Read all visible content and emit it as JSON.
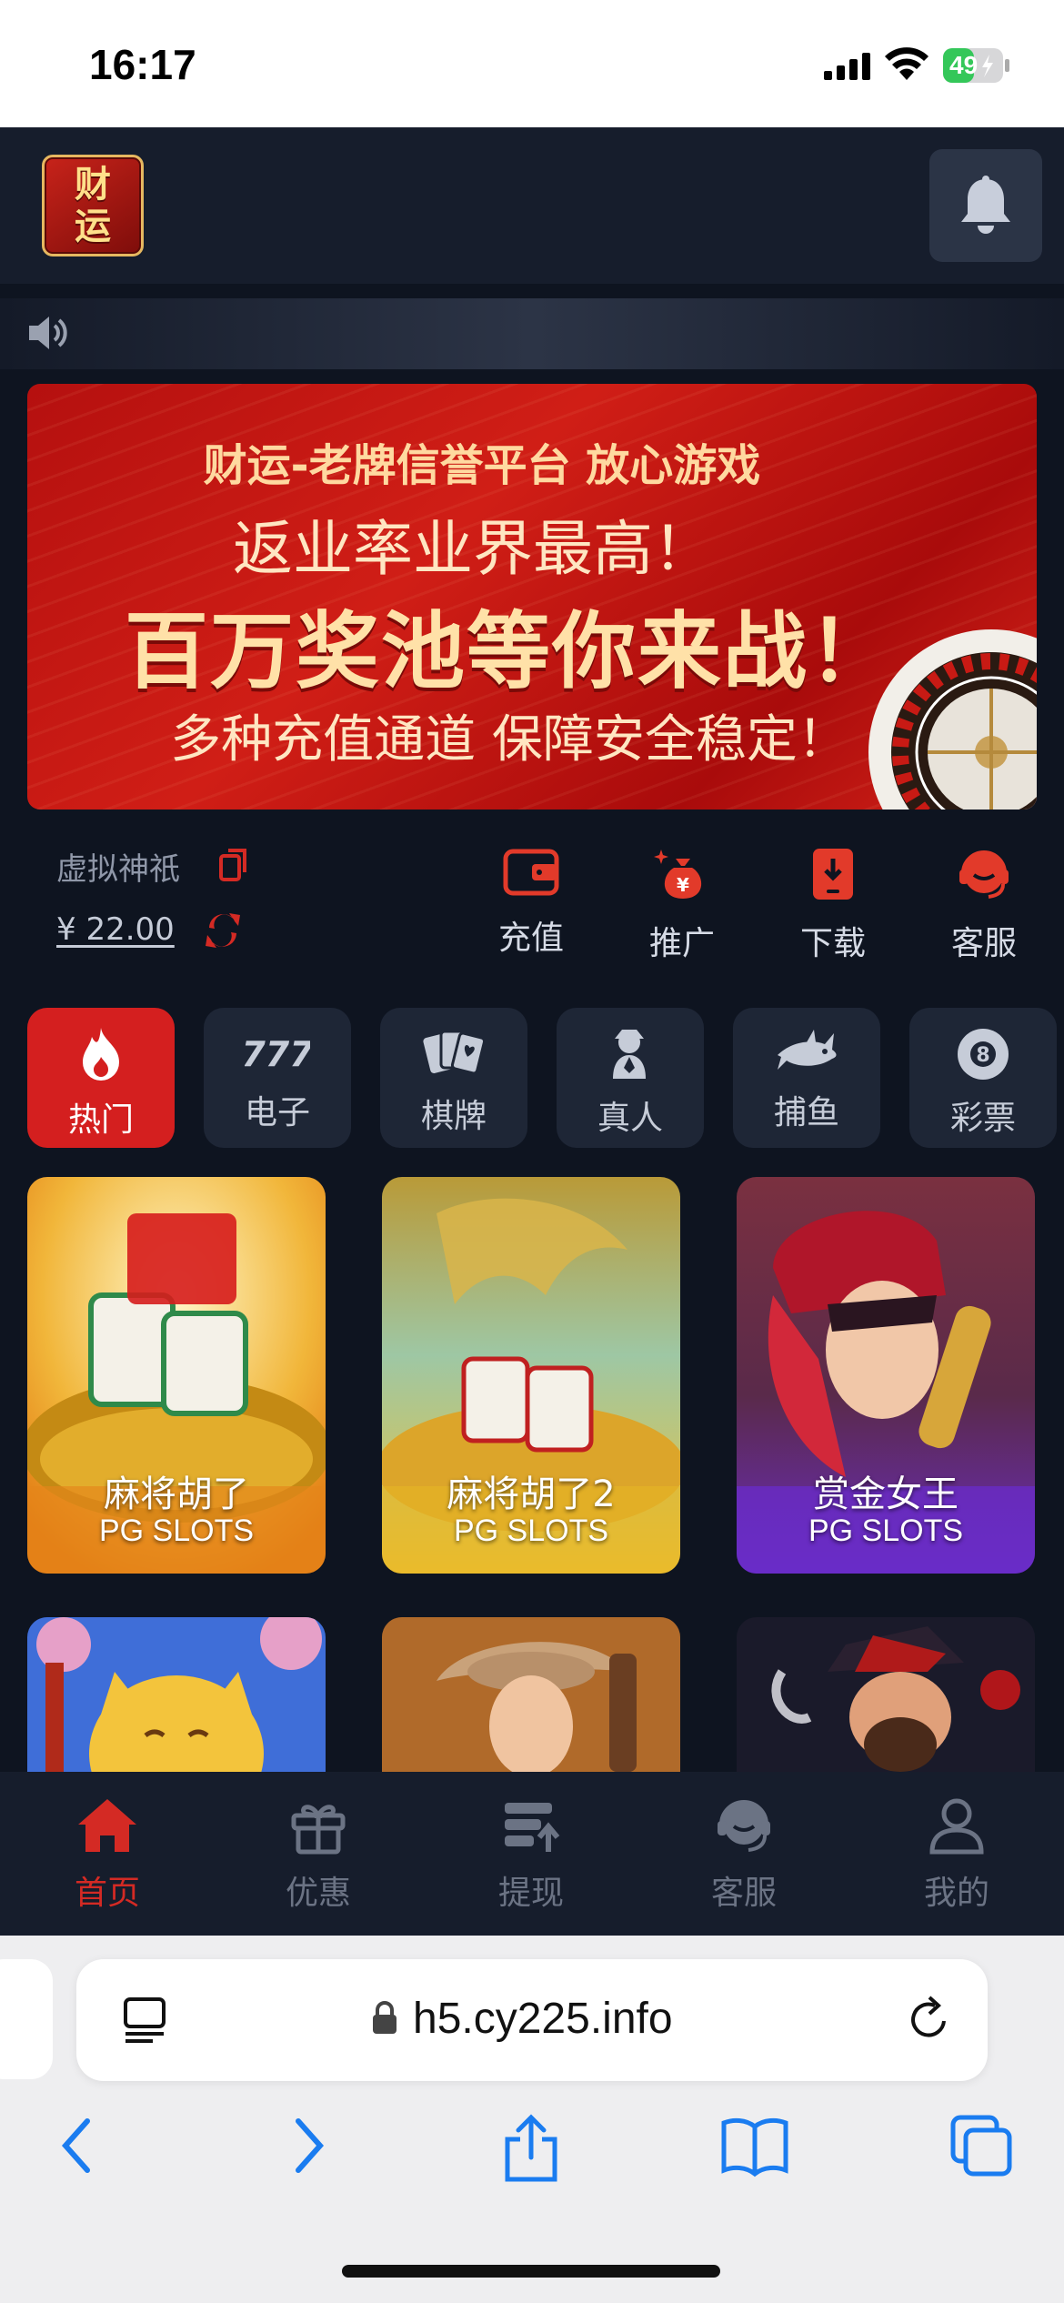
{
  "status_bar": {
    "time": "16:17",
    "battery": "49"
  },
  "header": {
    "logo_top": "财",
    "logo_bottom": "运"
  },
  "banner": {
    "line1": "财运-老牌信誉平台 放心游戏",
    "line2": "返业率业界最高！",
    "line3": "百万奖池等你来战！",
    "line4": "多种充值通道 保障安全稳定！"
  },
  "user": {
    "name": "虚拟神祇",
    "balance": "¥ 22.00"
  },
  "actions": [
    {
      "label": "充值",
      "icon": "wallet-icon"
    },
    {
      "label": "推广",
      "icon": "money-bag-icon"
    },
    {
      "label": "下载",
      "icon": "download-phone-icon"
    },
    {
      "label": "客服",
      "icon": "headset-icon"
    }
  ],
  "categories": [
    {
      "label": "热门",
      "icon": "fire-icon",
      "active": true
    },
    {
      "label": "电子",
      "icon": "slot-777-icon"
    },
    {
      "label": "棋牌",
      "icon": "cards-icon"
    },
    {
      "label": "真人",
      "icon": "dealer-icon"
    },
    {
      "label": "捕鱼",
      "icon": "shark-icon"
    },
    {
      "label": "彩票",
      "icon": "billiard-8-icon"
    }
  ],
  "games": [
    {
      "name": "麻将胡了",
      "provider": "PG SLOTS"
    },
    {
      "name": "麻将胡了2",
      "provider": "PG SLOTS"
    },
    {
      "name": "赏金女王",
      "provider": "PG SLOTS"
    }
  ],
  "bottom_nav": [
    {
      "label": "首页",
      "icon": "home-icon",
      "active": true
    },
    {
      "label": "优惠",
      "icon": "gift-icon"
    },
    {
      "label": "提现",
      "icon": "withdraw-icon"
    },
    {
      "label": "客服",
      "icon": "headset-icon"
    },
    {
      "label": "我的",
      "icon": "user-icon"
    }
  ],
  "browser": {
    "url": "h5.cy225.info"
  },
  "colors": {
    "accent": "#d41f1f",
    "background": "#0e1420",
    "panel": "#161d2c"
  }
}
